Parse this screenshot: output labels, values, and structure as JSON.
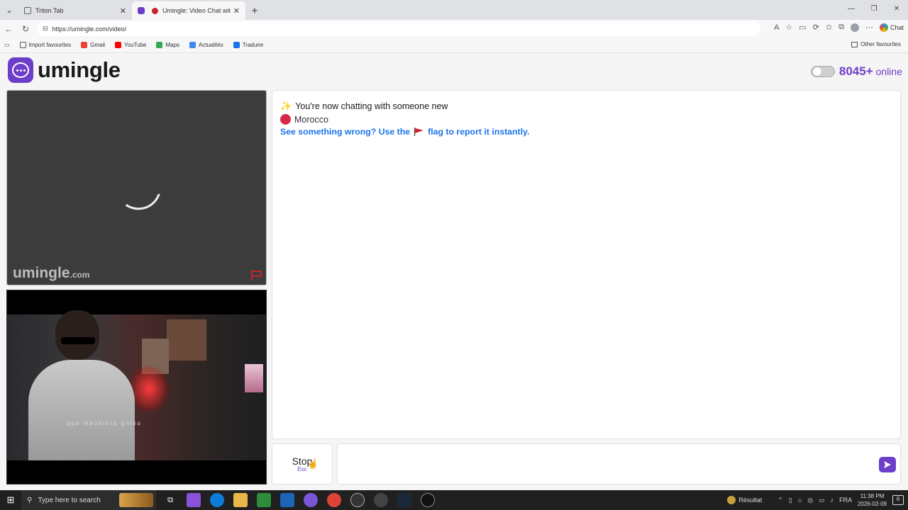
{
  "browser": {
    "tabs": [
      {
        "title": "Triton Tab",
        "active": false
      },
      {
        "title": "Umingle: Video Chat with Stra",
        "active": true
      }
    ],
    "new_tab": "+",
    "url": "https://umingle.com/video/",
    "chat_button": "Chat",
    "bookmarks": [
      "Import favourites",
      "Gmail",
      "YouTube",
      "Maps",
      "Actualités",
      "Traduire"
    ],
    "other_favourites": "Other favourites"
  },
  "header": {
    "logo_text": "umingle",
    "online_count": "8045+",
    "online_label": "online"
  },
  "colors": {
    "brand": "#6d3ec9",
    "link": "#1a73e8",
    "country_dot": "#d72a47"
  },
  "video": {
    "remote_watermark": "umingle",
    "remote_watermark_suffix": ".com",
    "local_caption": "using droidcam app"
  },
  "chat": {
    "line1": "You're now chatting with someone new",
    "country": "Morocco",
    "report_prefix": "See something wrong? Use the",
    "report_suffix": "flag to report it instantly."
  },
  "controls": {
    "stop_label": "Stop",
    "stop_shortcut": "Esc",
    "message_placeholder": ""
  },
  "taskbar": {
    "search_placeholder": "Type here to search",
    "weather": "Résultat",
    "language": "FRA",
    "time": "11:38 PM",
    "date": "2026-02-09",
    "notification_count": "6"
  }
}
